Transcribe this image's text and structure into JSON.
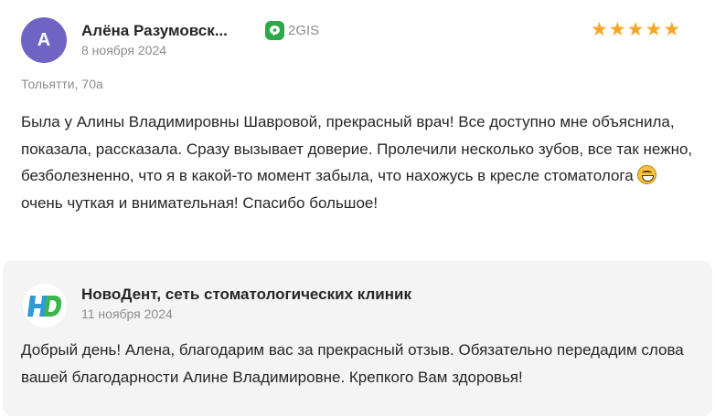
{
  "review": {
    "avatar_letter": "А",
    "author": "Алёна Разумовск...",
    "date": "8 ноября 2024",
    "source": {
      "label": "2GIS",
      "icon": "2gis-logo-icon",
      "color": "#2ea84a"
    },
    "rating": 5,
    "stars": [
      "★",
      "★",
      "★",
      "★",
      "★"
    ],
    "location": "Тольятти, 70а",
    "text_before_emoji": "Была у Алины Владимировны Шавровой, прекрасный врач! Все доступно мне объяснила, показала, рассказала. Сразу вызывает доверие. Пролечили несколько зубов, все так нежно, безболезненно, что я в какой-то момент забыла, что нахожусь в кресле стоматолога ",
    "emoji": "grinning-face-icon",
    "text_after_emoji": " очень чуткая и внимательная! Спасибо большое!"
  },
  "reply": {
    "author": "НовоДент, сеть стоматологических клиник",
    "date": "11 ноября 2024",
    "logo": "novodent-logo-icon",
    "text": "Добрый день! Алена, благодарим вас за прекрасный отзыв. Обязательно передадим слова вашей благодарности Алине Владимировне. Крепкого Вам здоровья!"
  },
  "colors": {
    "avatar": "#6f64c4",
    "star": "#f5a623",
    "secondary_text": "#8c8c8c",
    "reply_background": "#f4f4f4"
  }
}
